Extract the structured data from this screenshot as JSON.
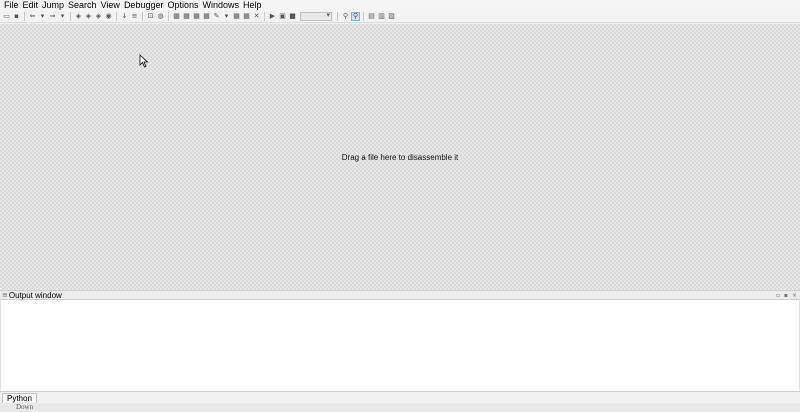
{
  "menu": {
    "items": [
      "File",
      "Edit",
      "Jump",
      "Search",
      "View",
      "Debugger",
      "Options",
      "Windows",
      "Help"
    ]
  },
  "main": {
    "drop_hint": "Drag a file here to disassemble it"
  },
  "output": {
    "title": "Output window"
  },
  "python": {
    "tab_label": "Python"
  },
  "status": {
    "text": "Down"
  }
}
